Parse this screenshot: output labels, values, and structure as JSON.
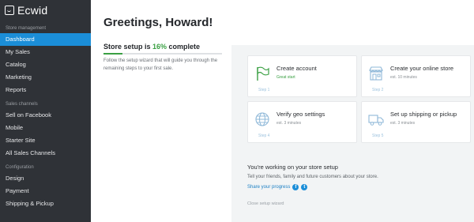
{
  "brand": {
    "name": "Ecwid"
  },
  "sidebar": {
    "sections": [
      {
        "title": "Store management",
        "items": [
          "Dashboard",
          "My Sales",
          "Catalog",
          "Marketing",
          "Reports"
        ]
      },
      {
        "title": "Sales channels",
        "items": [
          "Sell on Facebook",
          "Mobile",
          "Starter Site",
          "All Sales Channels"
        ]
      },
      {
        "title": "Configuration",
        "items": [
          "Design",
          "Payment",
          "Shipping & Pickup"
        ]
      }
    ],
    "active_item": "Dashboard"
  },
  "main": {
    "greeting": "Greetings, Howard!",
    "setup": {
      "title_prefix": "Store setup is ",
      "percent": "16%",
      "title_suffix": " complete",
      "progress_fraction": 0.16,
      "description": "Follow the setup wizard that will guide you through the remaining steps to your first sale."
    },
    "cards": [
      {
        "title": "Create account",
        "sub": "Great start",
        "step": "Step 1",
        "icon": "flag-icon"
      },
      {
        "title": "Create your online store",
        "sub": "est. 10 minutes",
        "step": "Step 2",
        "icon": "storefront-icon"
      },
      {
        "title": "Verify geo settings",
        "sub": "est. 3 minutes",
        "step": "Step 4",
        "icon": "globe-icon"
      },
      {
        "title": "Set up shipping or pickup",
        "sub": "est. 3 minutes",
        "step": "Step 5",
        "icon": "truck-icon"
      }
    ],
    "working": {
      "title": "You're working on your store setup",
      "description": "Tell your friends, family and future customers about your store.",
      "share": "Share your progress",
      "close": "Close setup wizard"
    }
  },
  "colors": {
    "sidebar_bg": "#2f3237",
    "active": "#1b8ed8",
    "success": "#3aa043"
  }
}
